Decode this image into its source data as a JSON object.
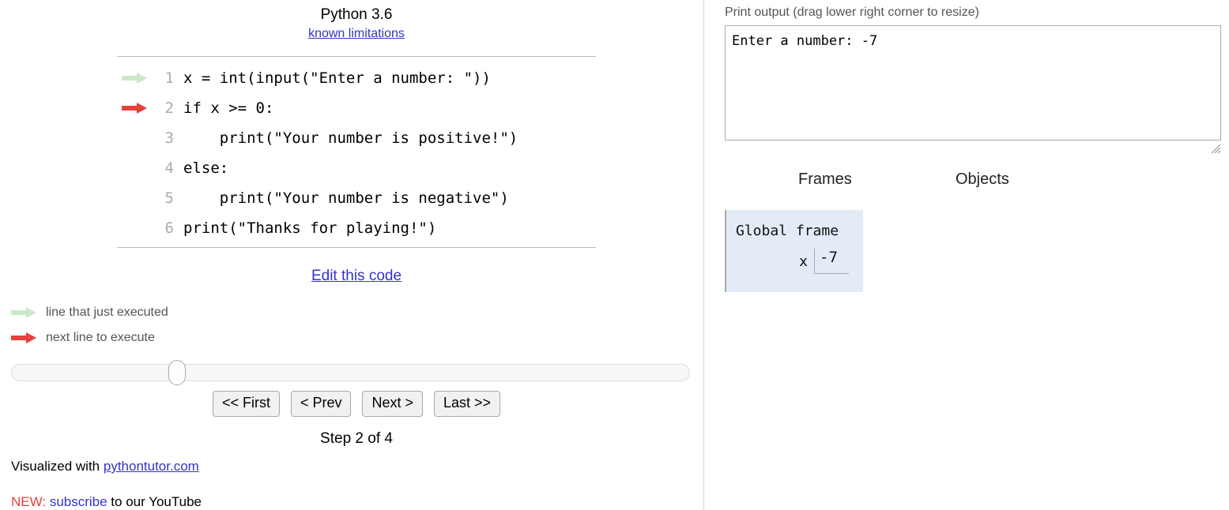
{
  "left_panel": {
    "language_title": "Python 3.6",
    "known_limitations_label": "known limitations",
    "code_lines": [
      {
        "lineno": "1",
        "text": "x = int(input(\"Enter a number: \"))",
        "arrow": "green"
      },
      {
        "lineno": "2",
        "text": "if x >= 0:",
        "arrow": "red"
      },
      {
        "lineno": "3",
        "text": "    print(\"Your number is positive!\")",
        "arrow": "none"
      },
      {
        "lineno": "4",
        "text": "else:",
        "arrow": "none"
      },
      {
        "lineno": "5",
        "text": "    print(\"Your number is negative\")",
        "arrow": "none"
      },
      {
        "lineno": "6",
        "text": "print(\"Thanks for playing!\")",
        "arrow": "none"
      }
    ],
    "edit_code_label": "Edit this code",
    "legend": {
      "just_executed_label": "line that just executed",
      "next_line_label": "next line to execute",
      "just_executed_color": "#c9e8c9",
      "next_line_color": "#e8403a"
    },
    "slider": {
      "value": 2,
      "min": 1,
      "max": 4
    },
    "buttons": {
      "first_label": "<< First",
      "prev_label": "< Prev",
      "next_label": "Next >",
      "last_label": "Last >>"
    },
    "step_label": "Step 2 of 4",
    "credit": {
      "prefix": "Visualized with ",
      "link_label": "pythontutor.com"
    },
    "promo": {
      "new_label": "NEW:",
      "link_label": "subscribe",
      "suffix": " to our YouTube"
    }
  },
  "right_panel": {
    "output_label": "Print output (drag lower right corner to resize)",
    "output_value": "Enter a number: -7",
    "resize_handle_icon": "resize-grip-icon",
    "frames_header": "Frames",
    "objects_header": "Objects",
    "frame": {
      "title": "Global frame",
      "variables": [
        {
          "name": "x",
          "value": "-7"
        }
      ],
      "background_color": "#e2ebf6"
    }
  }
}
